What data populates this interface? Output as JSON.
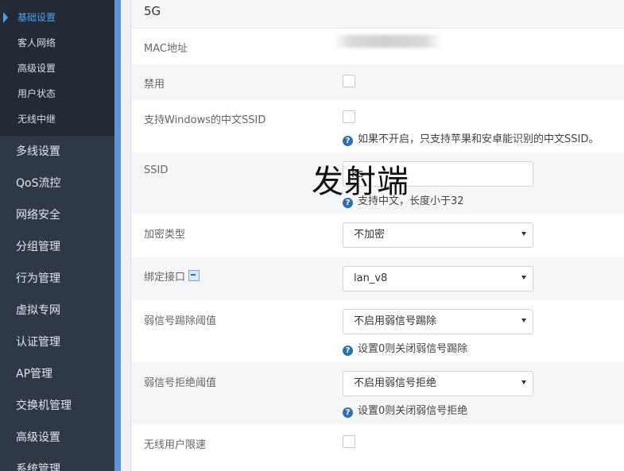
{
  "sidebar": {
    "sub_items": [
      {
        "label": "基础设置",
        "active": true
      },
      {
        "label": "客人网络"
      },
      {
        "label": "高级设置"
      },
      {
        "label": "用户状态"
      },
      {
        "label": "无线中继"
      }
    ],
    "menu_items": [
      {
        "label": "多线设置"
      },
      {
        "label": "QoS流控"
      },
      {
        "label": "网络安全"
      },
      {
        "label": "分组管理"
      },
      {
        "label": "行为管理"
      },
      {
        "label": "虚拟专网"
      },
      {
        "label": "认证管理"
      },
      {
        "label": "AP管理"
      },
      {
        "label": "交换机管理"
      },
      {
        "label": "高级设置"
      },
      {
        "label": "系统管理"
      }
    ]
  },
  "main": {
    "section_title": "5G",
    "mac": {
      "label": "MAC地址"
    },
    "disable": {
      "label": "禁用"
    },
    "win_ssid": {
      "label": "支持Windows的中文SSID",
      "help": "如果不开启，只支持苹果和安卓能识别的中文SSID。"
    },
    "ssid": {
      "label": "SSID",
      "value": "ks",
      "help": "支持中文，长度小于32"
    },
    "overlay": "发射端",
    "encryption": {
      "label": "加密类型",
      "value": "不加密"
    },
    "bind_iface": {
      "label": "绑定接口",
      "value": "lan_v8"
    },
    "kick_threshold": {
      "label": "弱信号踢除阈值",
      "value": "不启用弱信号踢除",
      "help": "设置0则关闭弱信号踢除"
    },
    "reject_threshold": {
      "label": "弱信号拒绝阈值",
      "value": "不启用弱信号拒绝",
      "help": "设置0则关闭弱信号拒绝"
    },
    "rate_limit": {
      "label": "无线用户限速"
    }
  },
  "colors": {
    "sidebar_bg": "#2e3846",
    "submenu_bg": "#222a35",
    "accent": "#4aa3f0",
    "strip": "#5f92d7",
    "help_icon": "#2d6fb0"
  },
  "icons": {
    "help": "question-circle-icon",
    "bind": "bind-interface-icon",
    "dropdown": "caret-down-icon",
    "active_marker": "triangle-right-icon"
  }
}
